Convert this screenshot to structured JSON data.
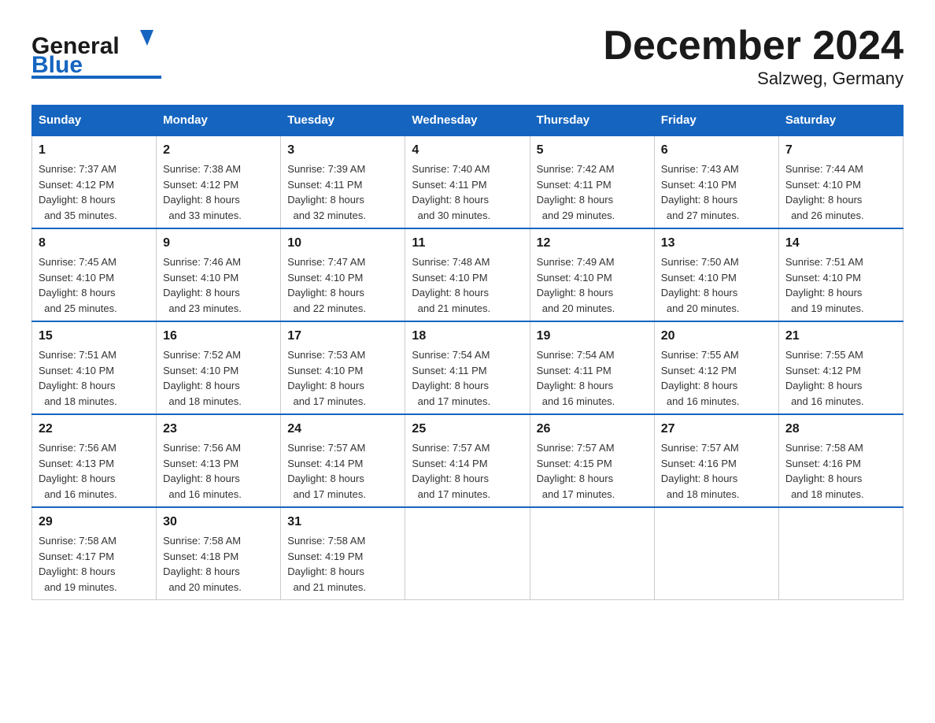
{
  "header": {
    "title": "December 2024",
    "subtitle": "Salzweg, Germany"
  },
  "weekdays": [
    "Sunday",
    "Monday",
    "Tuesday",
    "Wednesday",
    "Thursday",
    "Friday",
    "Saturday"
  ],
  "weeks": [
    [
      {
        "day": 1,
        "sunrise": "7:37 AM",
        "sunset": "4:12 PM",
        "daylight": "8 hours and 35 minutes."
      },
      {
        "day": 2,
        "sunrise": "7:38 AM",
        "sunset": "4:12 PM",
        "daylight": "8 hours and 33 minutes."
      },
      {
        "day": 3,
        "sunrise": "7:39 AM",
        "sunset": "4:11 PM",
        "daylight": "8 hours and 32 minutes."
      },
      {
        "day": 4,
        "sunrise": "7:40 AM",
        "sunset": "4:11 PM",
        "daylight": "8 hours and 30 minutes."
      },
      {
        "day": 5,
        "sunrise": "7:42 AM",
        "sunset": "4:11 PM",
        "daylight": "8 hours and 29 minutes."
      },
      {
        "day": 6,
        "sunrise": "7:43 AM",
        "sunset": "4:10 PM",
        "daylight": "8 hours and 27 minutes."
      },
      {
        "day": 7,
        "sunrise": "7:44 AM",
        "sunset": "4:10 PM",
        "daylight": "8 hours and 26 minutes."
      }
    ],
    [
      {
        "day": 8,
        "sunrise": "7:45 AM",
        "sunset": "4:10 PM",
        "daylight": "8 hours and 25 minutes."
      },
      {
        "day": 9,
        "sunrise": "7:46 AM",
        "sunset": "4:10 PM",
        "daylight": "8 hours and 23 minutes."
      },
      {
        "day": 10,
        "sunrise": "7:47 AM",
        "sunset": "4:10 PM",
        "daylight": "8 hours and 22 minutes."
      },
      {
        "day": 11,
        "sunrise": "7:48 AM",
        "sunset": "4:10 PM",
        "daylight": "8 hours and 21 minutes."
      },
      {
        "day": 12,
        "sunrise": "7:49 AM",
        "sunset": "4:10 PM",
        "daylight": "8 hours and 20 minutes."
      },
      {
        "day": 13,
        "sunrise": "7:50 AM",
        "sunset": "4:10 PM",
        "daylight": "8 hours and 20 minutes."
      },
      {
        "day": 14,
        "sunrise": "7:51 AM",
        "sunset": "4:10 PM",
        "daylight": "8 hours and 19 minutes."
      }
    ],
    [
      {
        "day": 15,
        "sunrise": "7:51 AM",
        "sunset": "4:10 PM",
        "daylight": "8 hours and 18 minutes."
      },
      {
        "day": 16,
        "sunrise": "7:52 AM",
        "sunset": "4:10 PM",
        "daylight": "8 hours and 18 minutes."
      },
      {
        "day": 17,
        "sunrise": "7:53 AM",
        "sunset": "4:10 PM",
        "daylight": "8 hours and 17 minutes."
      },
      {
        "day": 18,
        "sunrise": "7:54 AM",
        "sunset": "4:11 PM",
        "daylight": "8 hours and 17 minutes."
      },
      {
        "day": 19,
        "sunrise": "7:54 AM",
        "sunset": "4:11 PM",
        "daylight": "8 hours and 16 minutes."
      },
      {
        "day": 20,
        "sunrise": "7:55 AM",
        "sunset": "4:12 PM",
        "daylight": "8 hours and 16 minutes."
      },
      {
        "day": 21,
        "sunrise": "7:55 AM",
        "sunset": "4:12 PM",
        "daylight": "8 hours and 16 minutes."
      }
    ],
    [
      {
        "day": 22,
        "sunrise": "7:56 AM",
        "sunset": "4:13 PM",
        "daylight": "8 hours and 16 minutes."
      },
      {
        "day": 23,
        "sunrise": "7:56 AM",
        "sunset": "4:13 PM",
        "daylight": "8 hours and 16 minutes."
      },
      {
        "day": 24,
        "sunrise": "7:57 AM",
        "sunset": "4:14 PM",
        "daylight": "8 hours and 17 minutes."
      },
      {
        "day": 25,
        "sunrise": "7:57 AM",
        "sunset": "4:14 PM",
        "daylight": "8 hours and 17 minutes."
      },
      {
        "day": 26,
        "sunrise": "7:57 AM",
        "sunset": "4:15 PM",
        "daylight": "8 hours and 17 minutes."
      },
      {
        "day": 27,
        "sunrise": "7:57 AM",
        "sunset": "4:16 PM",
        "daylight": "8 hours and 18 minutes."
      },
      {
        "day": 28,
        "sunrise": "7:58 AM",
        "sunset": "4:16 PM",
        "daylight": "8 hours and 18 minutes."
      }
    ],
    [
      {
        "day": 29,
        "sunrise": "7:58 AM",
        "sunset": "4:17 PM",
        "daylight": "8 hours and 19 minutes."
      },
      {
        "day": 30,
        "sunrise": "7:58 AM",
        "sunset": "4:18 PM",
        "daylight": "8 hours and 20 minutes."
      },
      {
        "day": 31,
        "sunrise": "7:58 AM",
        "sunset": "4:19 PM",
        "daylight": "8 hours and 21 minutes."
      },
      null,
      null,
      null,
      null
    ]
  ],
  "labels": {
    "sunrise": "Sunrise:",
    "sunset": "Sunset:",
    "daylight": "Daylight:"
  }
}
